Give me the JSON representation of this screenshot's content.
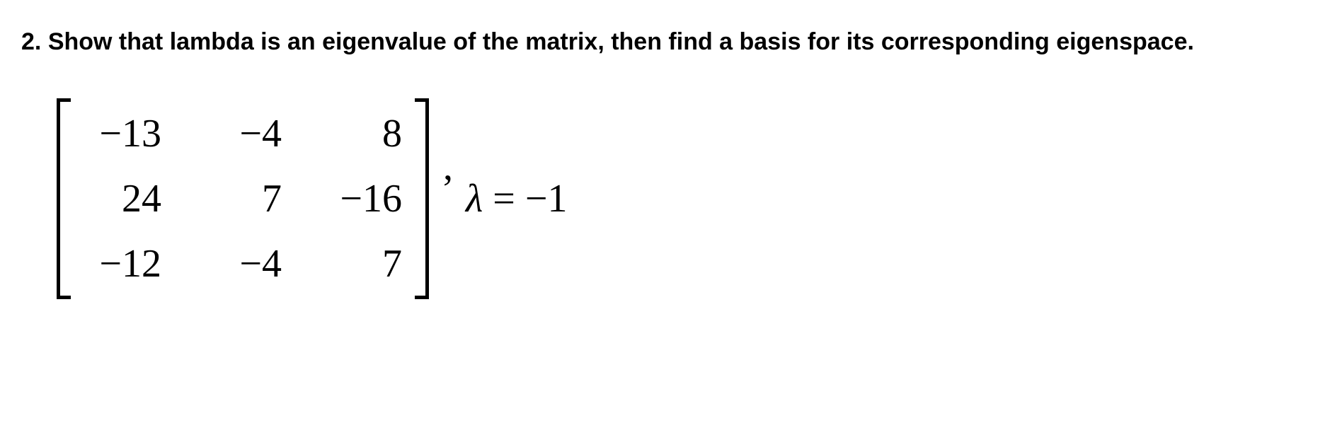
{
  "question": {
    "number": "2.",
    "text": "Show that lambda is an eigenvalue of the matrix, then find a basis for its corresponding eigenspace."
  },
  "matrix": {
    "rows": [
      [
        "−13",
        "−4",
        "8"
      ],
      [
        "24",
        "7",
        "−16"
      ],
      [
        "−12",
        "−4",
        "7"
      ]
    ]
  },
  "lambda": {
    "symbol": "λ",
    "equals": "=",
    "value": "−1"
  },
  "comma": ","
}
